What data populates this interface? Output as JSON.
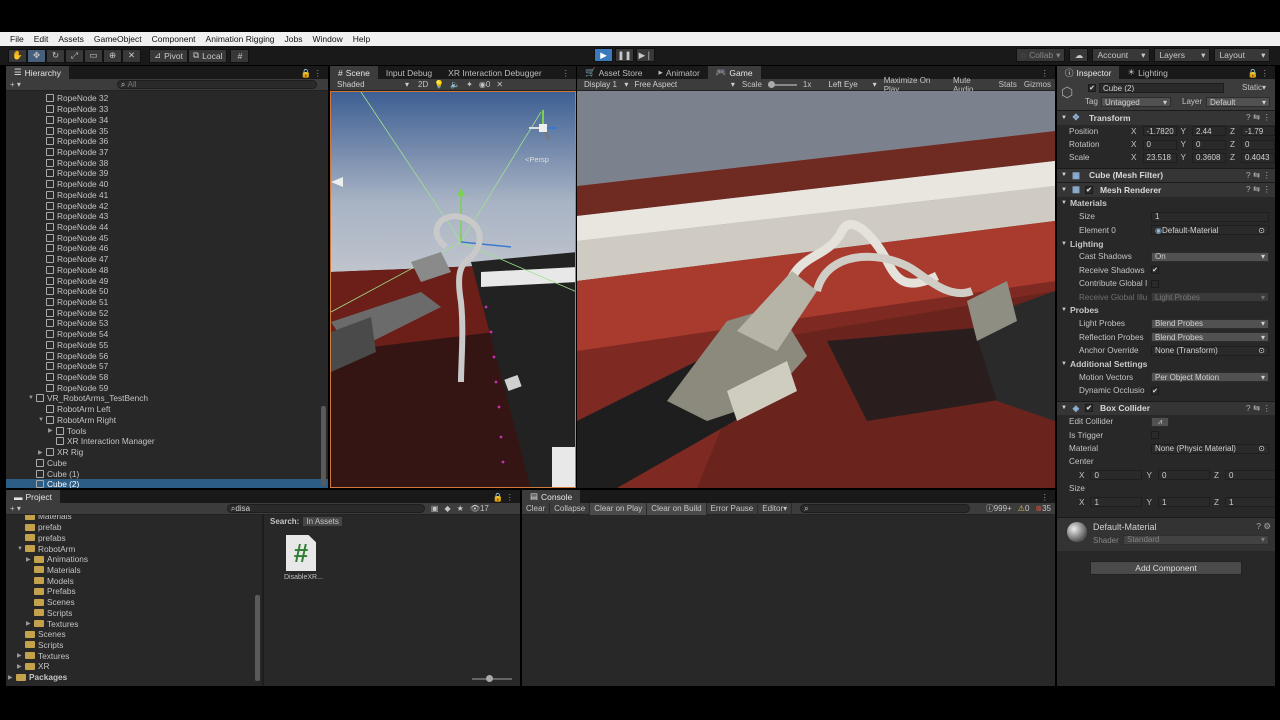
{
  "menu": [
    "File",
    "Edit",
    "Assets",
    "GameObject",
    "Component",
    "Animation Rigging",
    "Jobs",
    "Window",
    "Help"
  ],
  "toolbar": {
    "pivot": "Pivot",
    "local": "Local",
    "collab": "Collab",
    "account": "Account",
    "layers": "Layers",
    "layout": "Layout"
  },
  "hierarchy": {
    "tab": "Hierarchy",
    "search": "All",
    "items": [
      {
        "label": "RopeNode 32",
        "indent": 1
      },
      {
        "label": "RopeNode 33",
        "indent": 1
      },
      {
        "label": "RopeNode 34",
        "indent": 1
      },
      {
        "label": "RopeNode 35",
        "indent": 1
      },
      {
        "label": "RopeNode 36",
        "indent": 1
      },
      {
        "label": "RopeNode 37",
        "indent": 1
      },
      {
        "label": "RopeNode 38",
        "indent": 1
      },
      {
        "label": "RopeNode 39",
        "indent": 1
      },
      {
        "label": "RopeNode 40",
        "indent": 1
      },
      {
        "label": "RopeNode 41",
        "indent": 1
      },
      {
        "label": "RopeNode 42",
        "indent": 1
      },
      {
        "label": "RopeNode 43",
        "indent": 1
      },
      {
        "label": "RopeNode 44",
        "indent": 1
      },
      {
        "label": "RopeNode 45",
        "indent": 1
      },
      {
        "label": "RopeNode 46",
        "indent": 1
      },
      {
        "label": "RopeNode 47",
        "indent": 1
      },
      {
        "label": "RopeNode 48",
        "indent": 1
      },
      {
        "label": "RopeNode 49",
        "indent": 1
      },
      {
        "label": "RopeNode 50",
        "indent": 1
      },
      {
        "label": "RopeNode 51",
        "indent": 1
      },
      {
        "label": "RopeNode 52",
        "indent": 1
      },
      {
        "label": "RopeNode 53",
        "indent": 1
      },
      {
        "label": "RopeNode 54",
        "indent": 1
      },
      {
        "label": "RopeNode 55",
        "indent": 1
      },
      {
        "label": "RopeNode 56",
        "indent": 1
      },
      {
        "label": "RopeNode 57",
        "indent": 1
      },
      {
        "label": "RopeNode 58",
        "indent": 1
      },
      {
        "label": "RopeNode 59",
        "indent": 1
      },
      {
        "label": "VR_RobotArms_TestBench",
        "indent": 0,
        "expanded": true
      },
      {
        "label": "RobotArm Left",
        "indent": 1
      },
      {
        "label": "RobotArm Right",
        "indent": 1,
        "expanded": true
      },
      {
        "label": "Tools",
        "indent": 2,
        "collapsed": true
      },
      {
        "label": "XR Interaction Manager",
        "indent": 2
      },
      {
        "label": "XR Rig",
        "indent": 1,
        "collapsed": true
      },
      {
        "label": "Cube",
        "indent": 0
      },
      {
        "label": "Cube (1)",
        "indent": 0
      },
      {
        "label": "Cube (2)",
        "indent": 0,
        "selected": true
      }
    ]
  },
  "scene": {
    "tabs": [
      "Scene",
      "Input Debug",
      "XR Interaction Debugger"
    ],
    "shading": "Shaded",
    "mode2d": "2D",
    "persp": "<Persp"
  },
  "game": {
    "tabs": [
      "Asset Store",
      "Animator",
      "Game"
    ],
    "display": "Display 1",
    "aspect": "Free Aspect",
    "scale_label": "Scale",
    "scale": "1x",
    "eye": "Left Eye",
    "maximize": "Maximize On Play",
    "mute": "Mute Audio",
    "stats": "Stats",
    "gizmos": "Gizmos"
  },
  "project": {
    "tab": "Project",
    "search": "disa",
    "count": "17",
    "search_in": "Search:",
    "scope": "In Assets",
    "tree": [
      {
        "label": "Materials",
        "indent": 1
      },
      {
        "label": "prefab",
        "indent": 1
      },
      {
        "label": "prefabs",
        "indent": 1
      },
      {
        "label": "RobotArm",
        "indent": 1,
        "expanded": true
      },
      {
        "label": "Animations",
        "indent": 2,
        "collapsed": true
      },
      {
        "label": "Materials",
        "indent": 2
      },
      {
        "label": "Models",
        "indent": 2
      },
      {
        "label": "Prefabs",
        "indent": 2
      },
      {
        "label": "Scenes",
        "indent": 2
      },
      {
        "label": "Scripts",
        "indent": 2
      },
      {
        "label": "Textures",
        "indent": 2,
        "collapsed": true
      },
      {
        "label": "Scenes",
        "indent": 1
      },
      {
        "label": "Scripts",
        "indent": 1
      },
      {
        "label": "Textures",
        "indent": 1,
        "collapsed": true
      },
      {
        "label": "XR",
        "indent": 1,
        "collapsed": true
      },
      {
        "label": "Packages",
        "indent": 0,
        "collapsed": true,
        "bold": true
      }
    ],
    "asset": {
      "label": "DisableXR...",
      "glyph": "#"
    }
  },
  "console": {
    "tab": "Console",
    "buttons": [
      "Clear",
      "Collapse",
      "Clear on Play",
      "Clear on Build",
      "Error Pause",
      "Editor"
    ],
    "info_count": "999+",
    "warn_count": "0",
    "error_count": "35"
  },
  "inspector": {
    "tabs": [
      "Inspector",
      "Lighting"
    ],
    "object": "Cube (2)",
    "static": "Static",
    "tag_label": "Tag",
    "tag": "Untagged",
    "layer_label": "Layer",
    "layer": "Default",
    "transform": {
      "title": "Transform",
      "position": {
        "label": "Position",
        "x": "-1.7820",
        "y": "2.44",
        "z": "-1.79"
      },
      "rotation": {
        "label": "Rotation",
        "x": "0",
        "y": "0",
        "z": "0"
      },
      "scale": {
        "label": "Scale",
        "x": "23.518",
        "y": "0.3608",
        "z": "0.4043"
      }
    },
    "mesh_filter": "Cube (Mesh Filter)",
    "mesh_renderer": {
      "title": "Mesh Renderer",
      "materials": "Materials",
      "size_label": "Size",
      "size": "1",
      "elem_label": "Element 0",
      "elem": "Default-Material",
      "lighting": "Lighting",
      "cast_label": "Cast Shadows",
      "cast": "On",
      "receive_label": "Receive Shadows",
      "contrib_label": "Contribute Global I",
      "rgi_label": "Receive Global Illu",
      "rgi": "Light Probes",
      "probes": "Probes",
      "lp_label": "Light Probes",
      "lp": "Blend Probes",
      "rp_label": "Reflection Probes",
      "rp": "Blend Probes",
      "anchor_label": "Anchor Override",
      "anchor": "None (Transform)",
      "additional": "Additional Settings",
      "mv_label": "Motion Vectors",
      "mv": "Per Object Motion",
      "doc_label": "Dynamic Occlusio"
    },
    "box_collider": {
      "title": "Box Collider",
      "edit_label": "Edit Collider",
      "trigger_label": "Is Trigger",
      "material_label": "Material",
      "material": "None (Physic Material)",
      "center_label": "Center",
      "cx": "0",
      "cy": "0",
      "cz": "0",
      "size_label": "Size",
      "sx": "1",
      "sy": "1",
      "sz": "1"
    },
    "material": {
      "name": "Default-Material",
      "shader_label": "Shader",
      "shader": "Standard"
    },
    "add_component": "Add Component"
  }
}
